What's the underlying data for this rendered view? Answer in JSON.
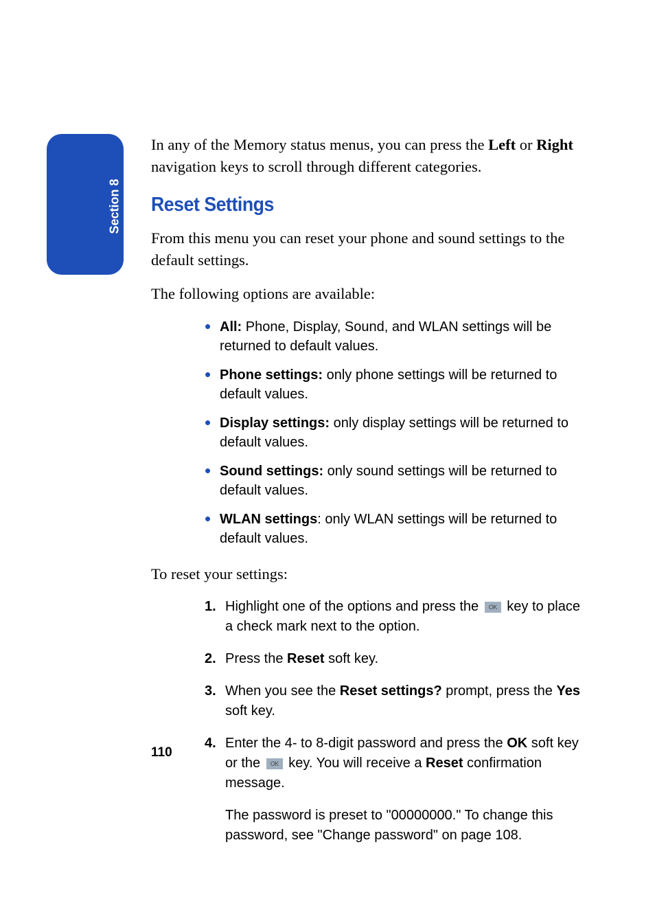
{
  "tab": {
    "label": "Section 8"
  },
  "intro": {
    "prefix": "In any of the Memory status menus, you can press the ",
    "key1": "Left",
    "mid": " or ",
    "key2": "Right",
    "suffix": " navigation keys to scroll through different categories."
  },
  "heading": "Reset Settings",
  "para1": "From this menu you can reset your phone and sound settings to the default settings.",
  "para2": "The following options are available:",
  "bullets": [
    {
      "label": "All:",
      "text": " Phone, Display, Sound, and WLAN settings will be returned to default values."
    },
    {
      "label": "Phone settings:",
      "text": " only phone settings will be returned to default values."
    },
    {
      "label": "Display settings:",
      "text": " only display settings will be returned to default values."
    },
    {
      "label": "Sound settings:",
      "text": " only sound settings will be returned to default values."
    },
    {
      "label": "WLAN settings",
      "text": ": only WLAN settings will be returned to default values."
    }
  ],
  "para3": "To reset your settings:",
  "steps": {
    "s1": {
      "pre": "Highlight one of the options and press the ",
      "post": " key to place a check mark next to the option."
    },
    "s2": {
      "pre": "Press the ",
      "b1": "Reset",
      "post": " soft key."
    },
    "s3": {
      "pre": "When you see the ",
      "b1": "Reset settings?",
      "mid": " prompt, press the ",
      "b2": "Yes",
      "post": " soft key."
    },
    "s4": {
      "pre": "Enter the 4- to 8-digit password and press the ",
      "b1": "OK",
      "mid1": " soft key or the ",
      "mid2": " key. You will receive a ",
      "b2": "Reset",
      "post": " confirmation message."
    },
    "note": "The password is preset to \"00000000.\" To change this password, see \"Change password\" on page 108."
  },
  "ok_glyph": "OK",
  "page_number": "110"
}
